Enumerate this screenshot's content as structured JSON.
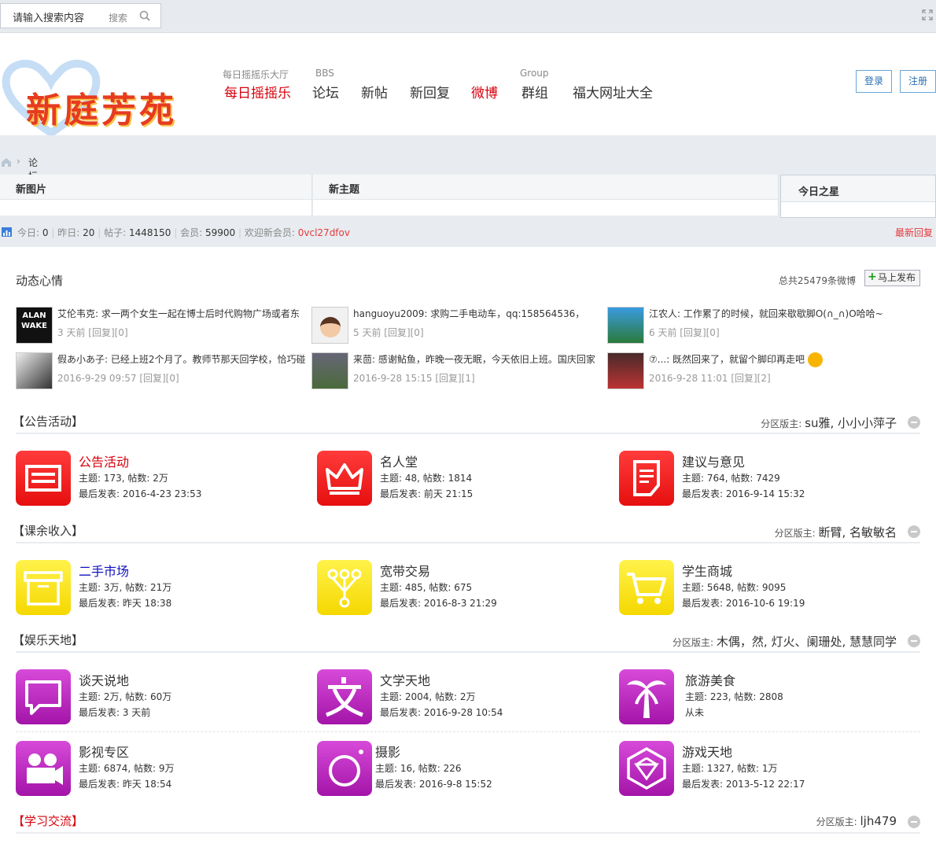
{
  "search": {
    "placeholder": "请输入搜索内容",
    "button": "搜索"
  },
  "logo": {
    "text": "新庭芳苑"
  },
  "nav": [
    {
      "sub": "每日摇摇乐大厅",
      "label": "每日摇摇乐"
    },
    {
      "sub": "BBS",
      "label": "论坛"
    },
    {
      "sub": "",
      "label": "新帖"
    },
    {
      "sub": "",
      "label": "新回复"
    },
    {
      "sub": "",
      "label": "微博"
    },
    {
      "sub": "Group",
      "label": "群组"
    },
    {
      "sub": "",
      "label": "福大网址大全"
    }
  ],
  "auth": {
    "login": "登录",
    "register": "注册"
  },
  "breadcrumb": {
    "current": "论坛"
  },
  "tabs": {
    "new_pics": "新图片",
    "new_topics": "新主题",
    "star": "今日之星"
  },
  "stats": {
    "today_label": "今日:",
    "today": "0",
    "yesterday_label": "昨日:",
    "yesterday": "20",
    "posts_label": "帖子:",
    "posts": "1448150",
    "members_label": "会员:",
    "members": "59900",
    "welcome_label": "欢迎新会员:",
    "newest": "0vcl27dfov",
    "latest_reply": "最新回复"
  },
  "mood": {
    "title": "动态心情",
    "total": "总共25479条微博",
    "publish": "马上发布",
    "items": [
      {
        "text": "艾伦韦克: 求一两个女生一起在博士后时代购物广场或者东",
        "meta": "3 天前 [回复][0]"
      },
      {
        "text": "hanguoyu2009: 求购二手电动车，qq:158564536，",
        "meta": "5 天前 [回复][0]"
      },
      {
        "text": "江农人: 工作累了的时候，就回来歇歇脚O(∩_∩)O哈哈~",
        "meta": "6 天前 [回复][0]"
      },
      {
        "text": "假あ小あ子: 已经上班2个月了。教师节那天回学校，恰巧碰",
        "meta": "2016-9-29 09:57 [回复][0]"
      },
      {
        "text": "来茴: 感谢鲇鱼，昨晚一夜无眠，今天依旧上班。国庆回家",
        "meta": "2016-9-28 15:15 [回复][1]"
      },
      {
        "text": "⑦...: 既然回来了，就留个脚印再走吧",
        "meta": "2016-9-28 11:01 [回复][2]"
      }
    ]
  },
  "sections": [
    {
      "title": "【公告活动】",
      "mods_label": "分区版主:",
      "mods": "su雅, 小小小萍子",
      "forums": [
        {
          "name": "公告活动",
          "stats": "主题: 173, 帖数: 2万",
          "last": "最后发表: 2016-4-23 23:53"
        },
        {
          "name": "名人堂",
          "stats": "主题: 48, 帖数: 1814",
          "last": "最后发表: 前天 21:15"
        },
        {
          "name": "建议与意见",
          "stats": "主题: 764, 帖数: 7429",
          "last": "最后发表: 2016-9-14 15:32"
        }
      ]
    },
    {
      "title": "【课余收入】",
      "mods_label": "分区版主:",
      "mods": "断臂, 名敏敏名",
      "forums": [
        {
          "name": "二手市场",
          "stats": "主题: 3万, 帖数: 21万",
          "last": "最后发表: 昨天 18:38"
        },
        {
          "name": "宽带交易",
          "stats": "主题: 485, 帖数: 675",
          "last": "最后发表: 2016-8-3 21:29"
        },
        {
          "name": "学生商城",
          "stats": "主题: 5648, 帖数: 9095",
          "last": "最后发表: 2016-10-6 19:19"
        }
      ]
    },
    {
      "title": "【娱乐天地】",
      "mods_label": "分区版主:",
      "mods": "木偶，然, 灯火、阑珊处, 慧慧同学",
      "forums": [
        {
          "name": "谈天说地",
          "stats": "主题: 2万, 帖数: 60万",
          "last": "最后发表: 3 天前"
        },
        {
          "name": "文学天地",
          "stats": "主题: 2004, 帖数: 2万",
          "last": "最后发表: 2016-9-28 10:54"
        },
        {
          "name": "旅游美食",
          "stats": "主题: 223, 帖数: 2808",
          "last": "从未"
        },
        {
          "name": "影视专区",
          "stats": "主题: 6874, 帖数: 9万",
          "last": "最后发表: 昨天 18:54"
        },
        {
          "name": "摄影",
          "stats": "主题: 16, 帖数: 226",
          "last": "最后发表: 2016-9-8 15:52"
        },
        {
          "name": "游戏天地",
          "stats": "主题: 1327, 帖数: 1万",
          "last": "最后发表: 2013-5-12 22:17"
        }
      ]
    },
    {
      "title": "【学习交流】",
      "mods_label": "分区版主:",
      "mods": "ljh479",
      "forums": []
    }
  ],
  "colors": {
    "accent_red": "#d8000c",
    "link_blue": "#1010c0",
    "icon_red": "#f01c1c",
    "icon_yellow": "#f8e21a",
    "icon_purple": "#bd2dc1"
  }
}
